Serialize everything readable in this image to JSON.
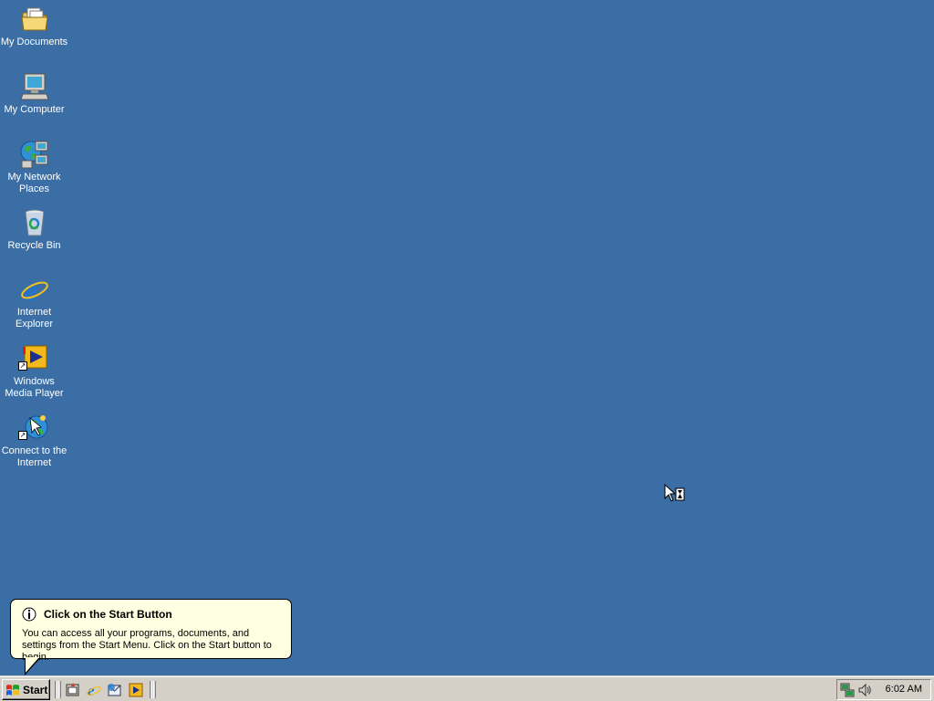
{
  "desktop": {
    "background": "#3a6ea5",
    "icons": [
      {
        "label": "My Documents",
        "icon": "folder-documents-icon"
      },
      {
        "label": "My Computer",
        "icon": "computer-icon"
      },
      {
        "label": "My Network\nPlaces",
        "icon": "network-places-icon"
      },
      {
        "label": "Recycle Bin",
        "icon": "recycle-bin-icon"
      },
      {
        "label": "Internet\nExplorer",
        "icon": "internet-explorer-icon"
      },
      {
        "label": "Windows\nMedia Player",
        "icon": "media-player-icon"
      },
      {
        "label": "Connect to the\nInternet",
        "icon": "connect-internet-icon"
      }
    ]
  },
  "balloon": {
    "title": "Click on the Start Button",
    "body": "You can access all your programs, documents, and settings from the Start Menu. Click on the Start button to begin.",
    "icon": "info-icon"
  },
  "taskbar": {
    "start_label": "Start",
    "quick_launch": [
      "show-desktop-icon",
      "internet-explorer-icon",
      "outlook-express-icon",
      "media-player-icon"
    ],
    "tray_icons": [
      "network-status-icon",
      "volume-icon"
    ],
    "clock": "6:02 AM"
  }
}
